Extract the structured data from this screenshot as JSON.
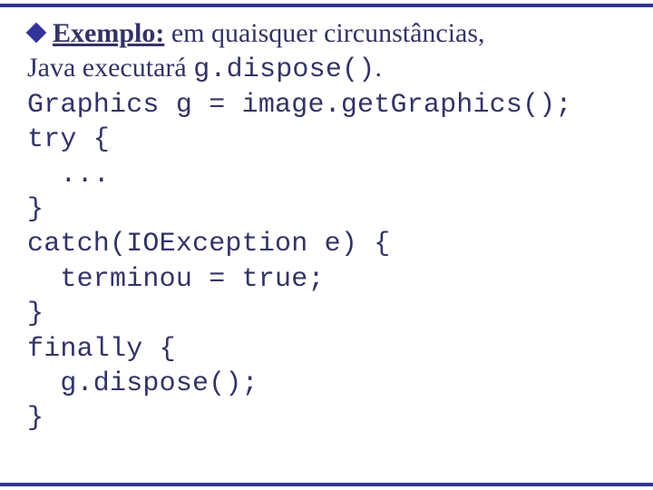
{
  "bullet": {
    "label": "Exemplo:",
    "text_after_label": " em quaisquer circunstâncias,",
    "line2_prefix": "Java executará ",
    "line2_code": "g.dispose()",
    "line2_suffix": "."
  },
  "code_lines": {
    "l0": "Graphics g = image.getGraphics();",
    "l1": "try {",
    "l2": "  ...",
    "l3": "}",
    "l4": "catch(IOException e) {",
    "l5": "  terminou = true;",
    "l6": "}",
    "l7": "finally {",
    "l8": "  g.dispose();",
    "l9": "}"
  }
}
